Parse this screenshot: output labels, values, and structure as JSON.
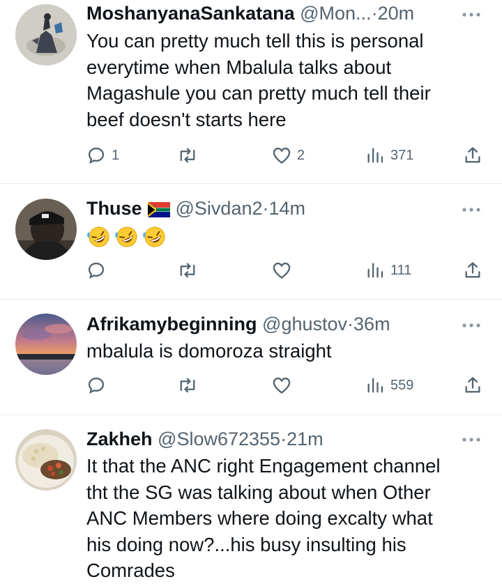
{
  "tweets": [
    {
      "name": "MoshanyanaSankatana",
      "handle": "@Mon...",
      "separator": "·",
      "time": "20m",
      "has_flag": false,
      "lines": [
        "You can pretty much tell this is personal",
        "everytime when Mbalula talks about",
        "Magashule you can pretty much tell their",
        "beef doesn't starts here"
      ],
      "emoji": [],
      "replies": "1",
      "retweets": "",
      "likes": "2",
      "views": "371",
      "avatar": {
        "bg": "#b9b9b2",
        "fg": "#3b3f4a"
      }
    },
    {
      "name": "Thuse",
      "handle": "@Sivdan2",
      "separator": "·",
      "time": "14m",
      "has_flag": true,
      "lines": [],
      "emoji": [
        "rolling-on-floor-laughing",
        "rolling-on-floor-laughing",
        "rolling-on-floor-laughing"
      ],
      "replies": "",
      "retweets": "",
      "likes": "",
      "views": "111",
      "avatar": {
        "bg": "#5a5148",
        "fg": "#171717"
      }
    },
    {
      "name": "Afrikamybeginning",
      "handle": "@ghustov",
      "separator": "·",
      "time": "36m",
      "has_flag": false,
      "lines": [
        "mbalula is domoroza straight"
      ],
      "emoji": [],
      "replies": "",
      "retweets": "",
      "likes": "",
      "views": "559",
      "avatar": {
        "bg": "#6d5f8c",
        "fg": "#e9a46c"
      }
    },
    {
      "name": "Zakheh",
      "handle": "@Slow672355",
      "separator": "·",
      "time": "21m",
      "has_flag": false,
      "lines": [
        "It that the ANC right  Engagement channel",
        "tht the SG was talking about when Other",
        "ANC Members  where doing excalty what",
        "his doing now?...his busy insulting his",
        "Comrades"
      ],
      "emoji": [],
      "replies": "",
      "retweets": "",
      "likes": "",
      "views": "",
      "avatar": {
        "bg": "#ece5d8",
        "fg": "#c9b98e"
      }
    }
  ],
  "colors": {
    "text": "#0f1419",
    "muted": "#536471",
    "divider": "#e6ecf0"
  },
  "icons": [
    "reply-icon",
    "retweet-icon",
    "like-icon",
    "views-icon",
    "share-icon",
    "more-icon"
  ]
}
